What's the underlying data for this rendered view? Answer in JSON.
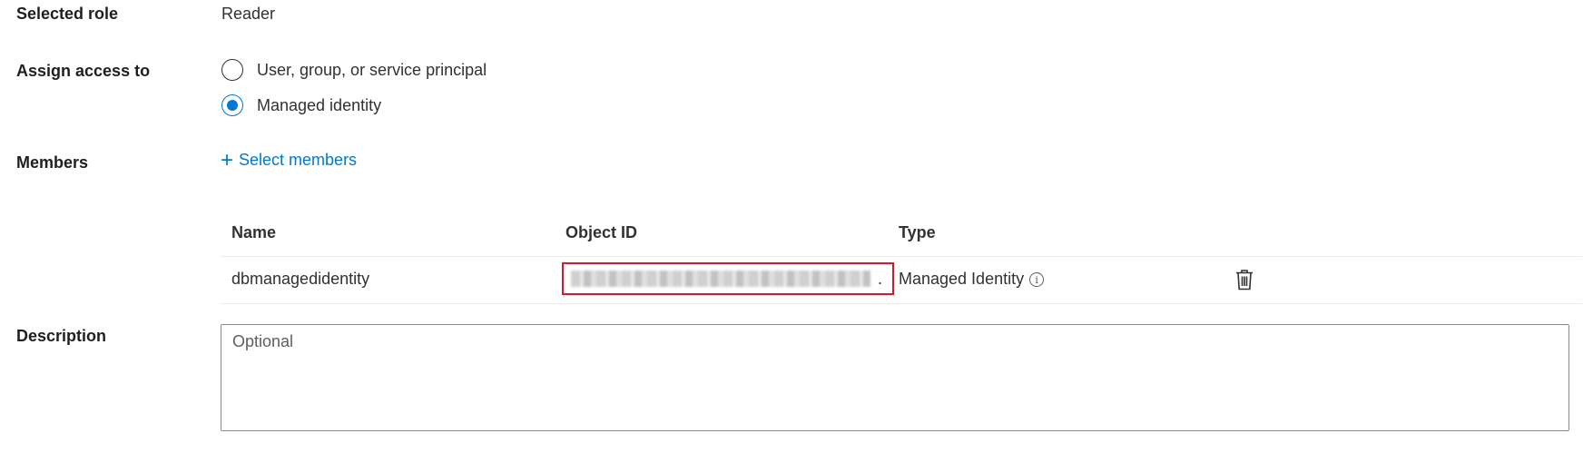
{
  "selected_role": {
    "label": "Selected role",
    "value": "Reader"
  },
  "assign_access": {
    "label": "Assign access to",
    "options": [
      {
        "label": "User, group, or service principal",
        "selected": false
      },
      {
        "label": "Managed identity",
        "selected": true
      }
    ]
  },
  "members": {
    "label": "Members",
    "select_link": "Select members",
    "columns": [
      "Name",
      "Object ID",
      "Type"
    ],
    "rows": [
      {
        "name": "dbmanagedidentity",
        "object_id_suffix": ".",
        "type": "Managed Identity"
      }
    ]
  },
  "description": {
    "label": "Description",
    "placeholder": "Optional",
    "value": ""
  },
  "colors": {
    "accent": "#0078d4",
    "highlight": "#e81123"
  },
  "icons": {
    "add": "plus-icon",
    "info": "info-icon",
    "delete": "trash-icon"
  }
}
